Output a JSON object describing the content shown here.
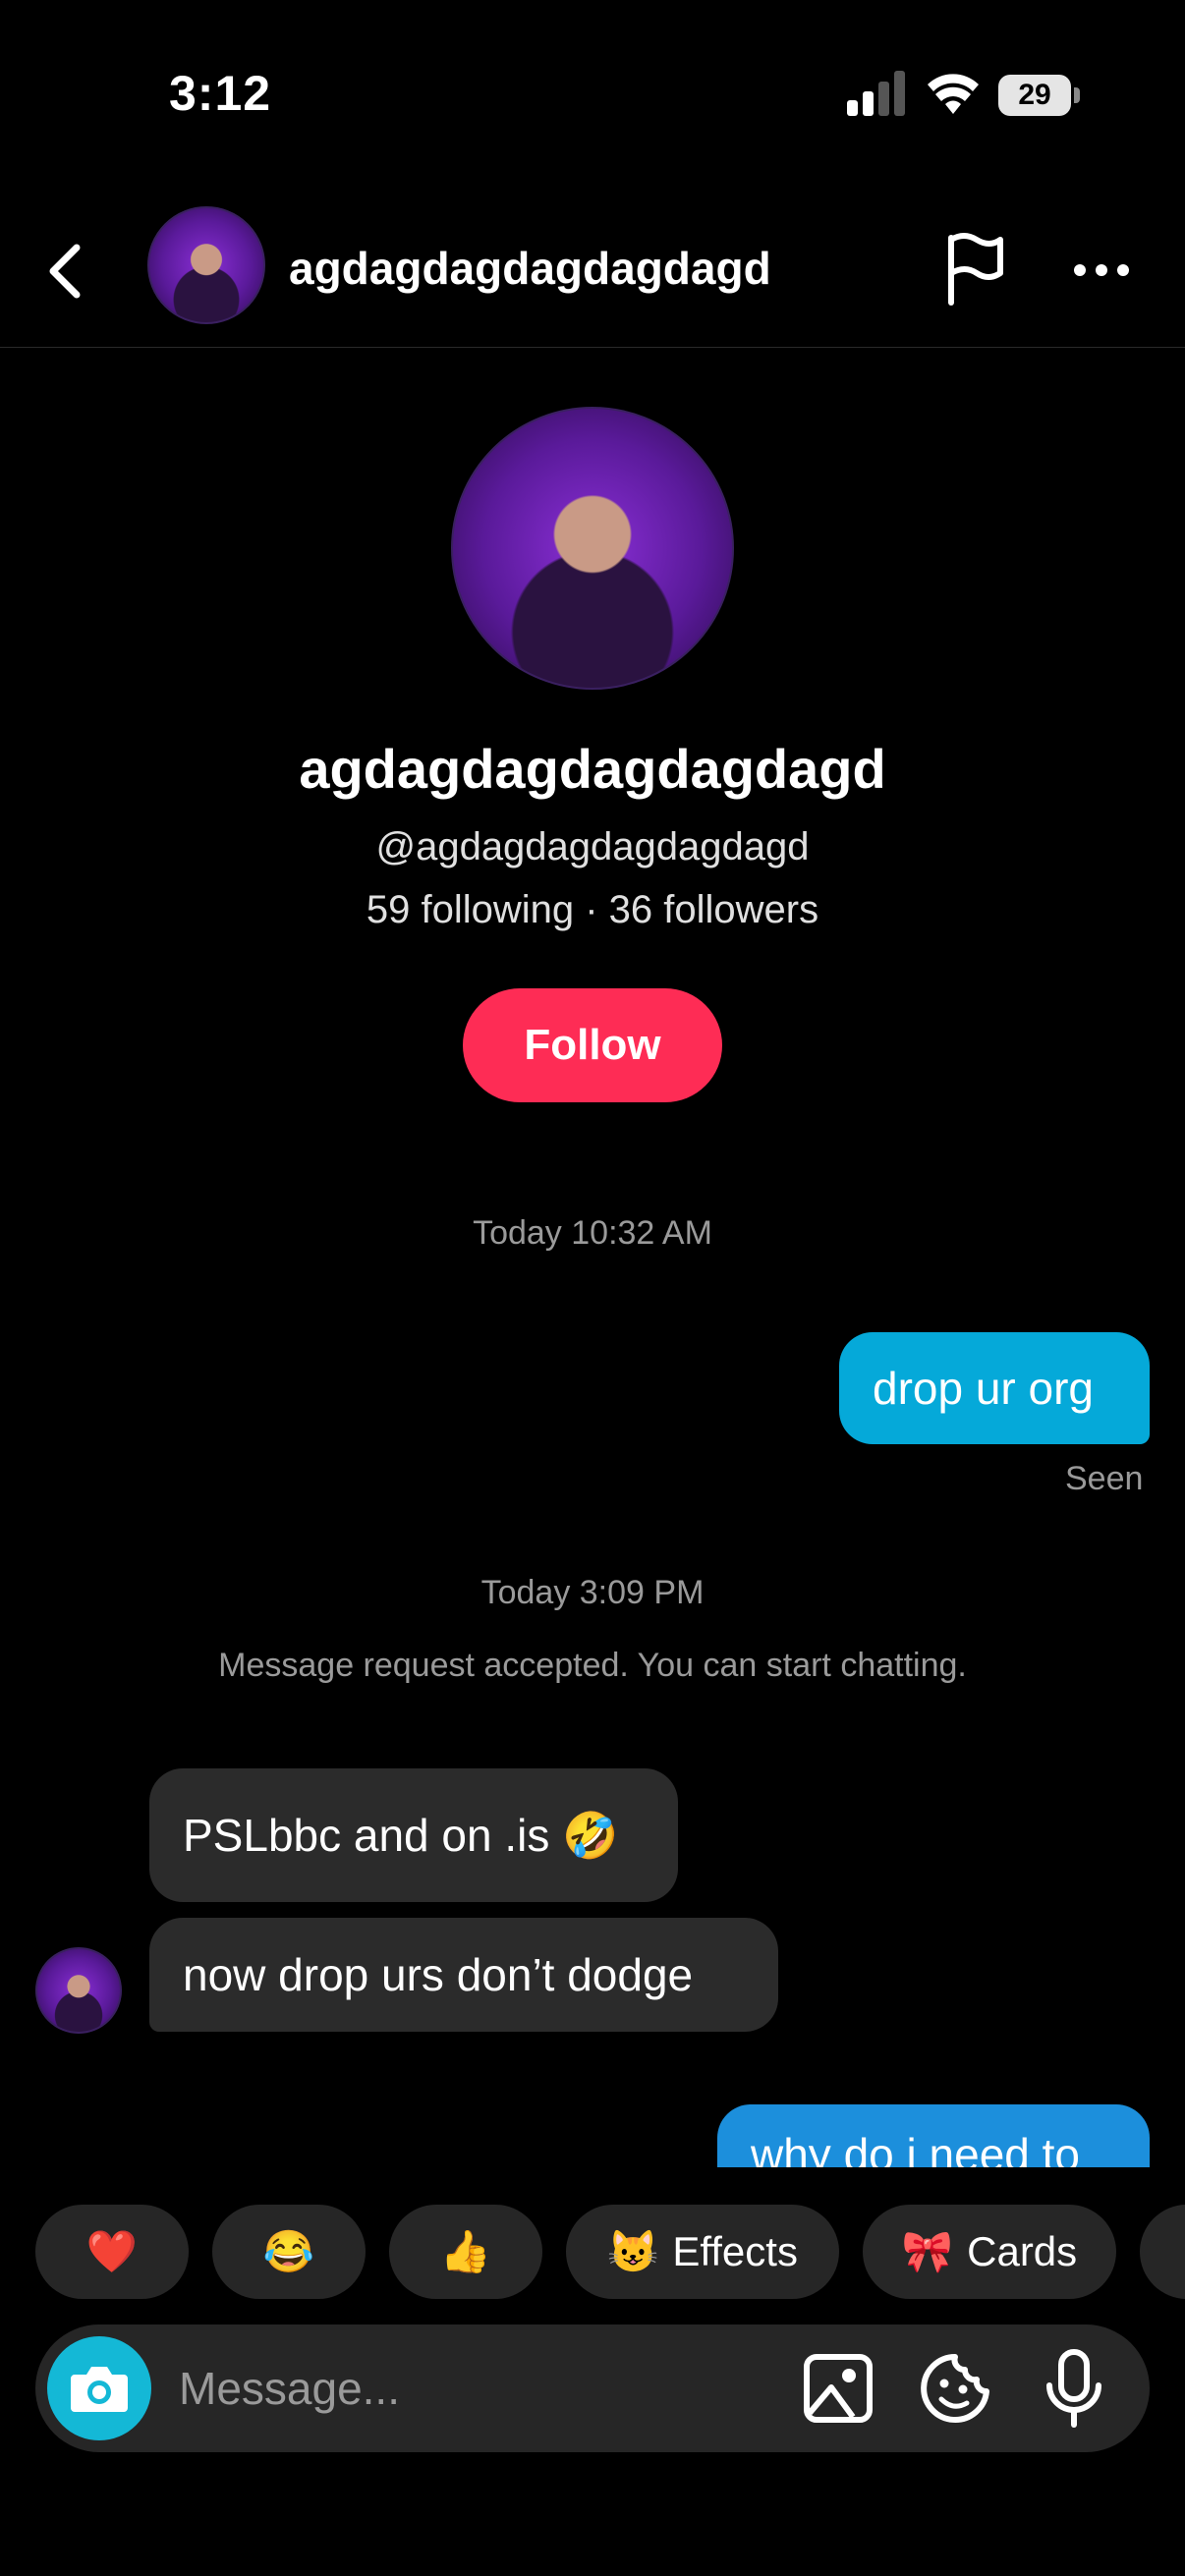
{
  "status_bar": {
    "time": "3:12",
    "battery": "29"
  },
  "header": {
    "username": "agdagdagdagdagdagd"
  },
  "profile": {
    "display_name": "agdagdagdagdagdagd",
    "handle": "@agdagdagdagdagdagd",
    "stats": "59 following · 36 followers",
    "follow_label": "Follow"
  },
  "chat": {
    "timestamp_1": "Today 10:32 AM",
    "outgoing_1": "drop ur org",
    "seen_label": "Seen",
    "timestamp_2": "Today 3:09 PM",
    "system_message": "Message request accepted. You can start chatting.",
    "incoming_1": "PSLbbc and on .is 🤣",
    "incoming_2": "now drop urs don’t dodge",
    "outgoing_2_partial": "why do i need to"
  },
  "quick_actions": {
    "heart": "❤️",
    "laugh": "😂",
    "thumbs_up": "👍",
    "effects_emoji": "😺",
    "effects_label": "Effects",
    "cards_emoji": "🎀",
    "cards_label": "Cards"
  },
  "composer": {
    "placeholder": "Message..."
  },
  "colors": {
    "follow": "#fe2c55",
    "outgoing_bubble": "#05a9d9",
    "incoming_bubble": "#2b2b2b",
    "camera": "#14b8d6"
  }
}
